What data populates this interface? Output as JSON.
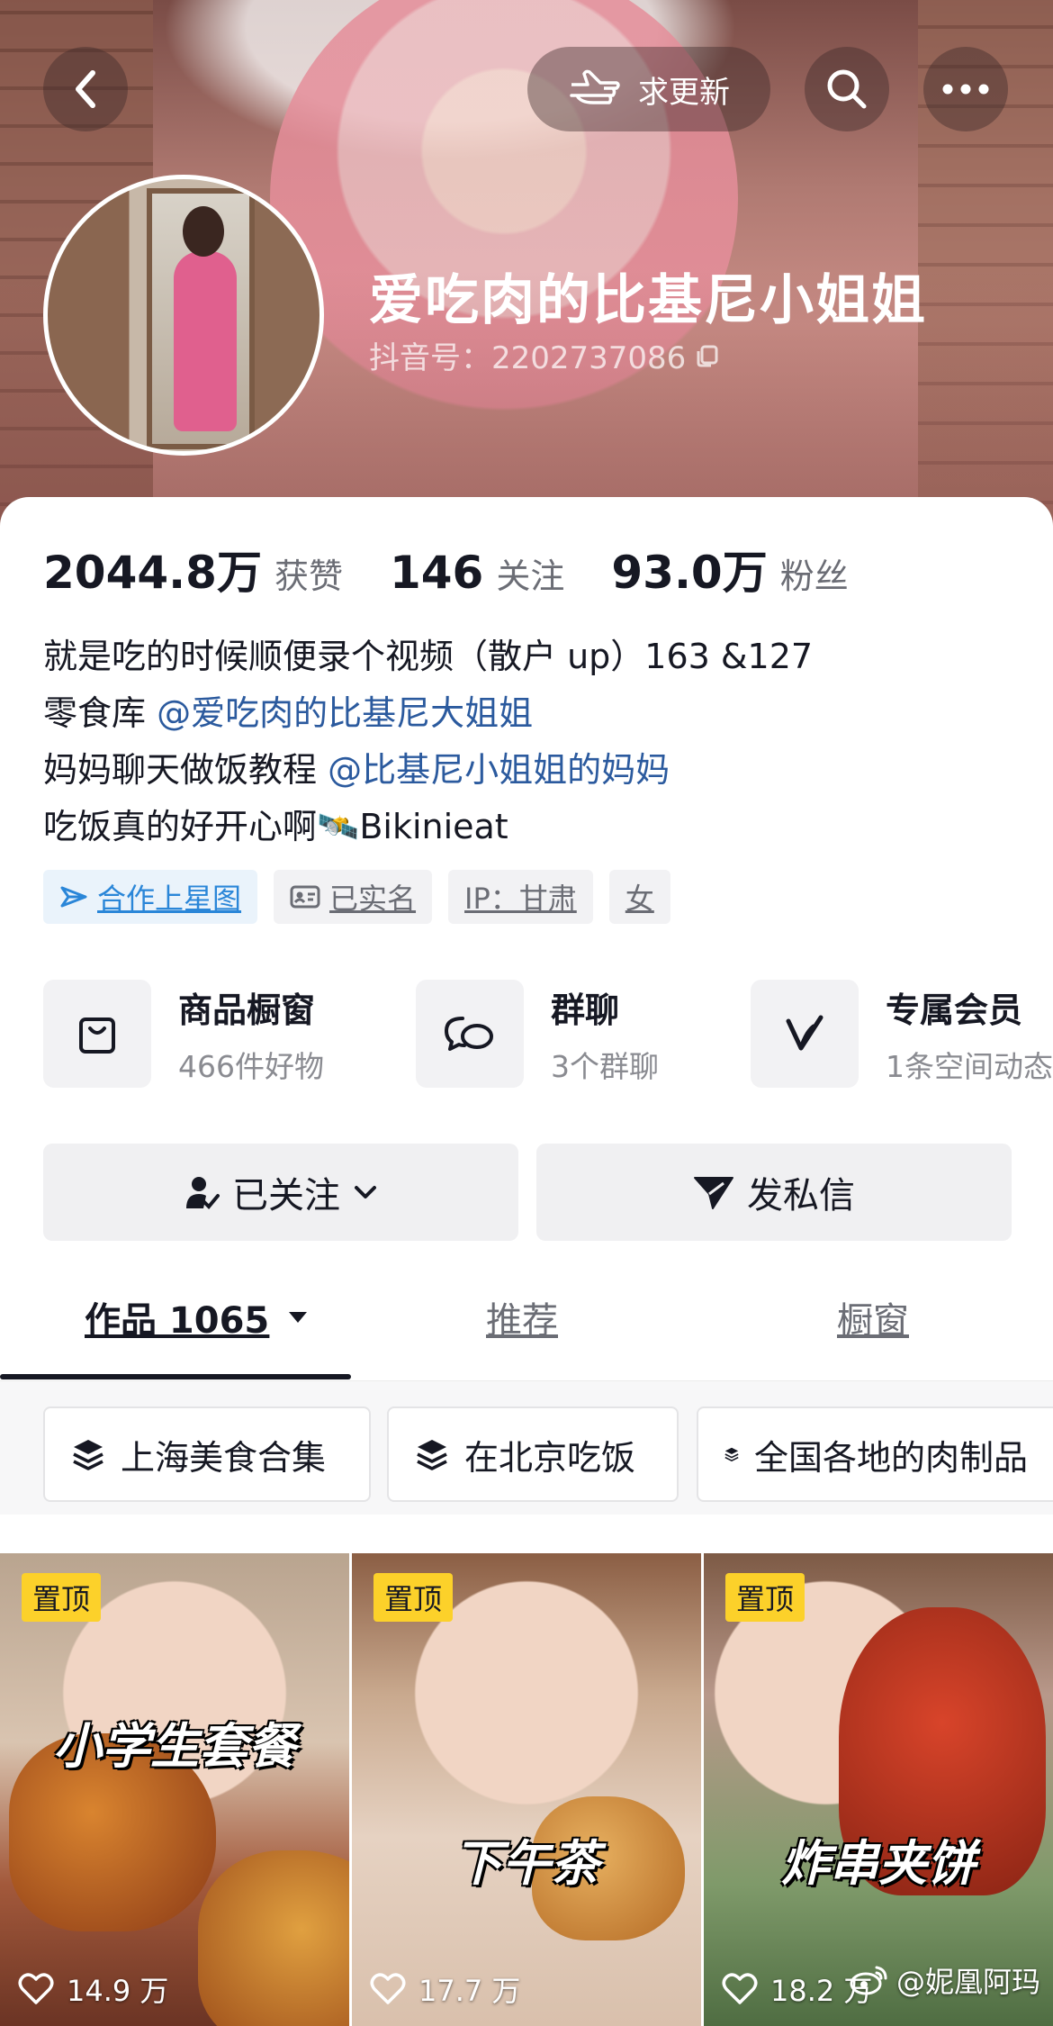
{
  "header": {
    "update_label": "求更新",
    "username": "爱吃肉的比基尼小姐姐",
    "douyin_id": "抖音号：2202737086"
  },
  "stats": {
    "likes_value": "2044.8万",
    "likes_label": "获赞",
    "following_value": "146",
    "following_label": "关注",
    "followers_value": "93.0万",
    "followers_label": "粉丝"
  },
  "bio": {
    "line1": "就是吃的时候顺便录个视频（散户 up）163 &127",
    "line2_prefix": "零食库 ",
    "line2_mention": "@爱吃肉的比基尼大姐姐",
    "line3_prefix": "妈妈聊天做饭教程 ",
    "line3_mention": "@比基尼小姐姐的妈妈",
    "line4": "吃饭真的好开心啊🛰️Bikinieat"
  },
  "tags": {
    "star_map": "合作上星图",
    "verified": "已实名",
    "ip": "IP：甘肃",
    "gender": "女"
  },
  "features": [
    {
      "title": "商品橱窗",
      "subtitle": "466件好物",
      "icon": "shopping-bag-icon"
    },
    {
      "title": "群聊",
      "subtitle": "3个群聊",
      "icon": "chat-bubbles-icon"
    },
    {
      "title": "专属会员",
      "subtitle": "1条空间动态",
      "icon": "vip-v-icon"
    }
  ],
  "actions": {
    "followed_label": "已关注",
    "message_label": "发私信"
  },
  "tabs": {
    "works": "作品 1065",
    "recommend": "推荐",
    "showcase": "橱窗"
  },
  "collections": [
    "上海美食合集",
    "在北京吃饭",
    "全国各地的肉制品"
  ],
  "videos": [
    {
      "pin": "置顶",
      "title": "小学生套餐",
      "likes": "14.9 万"
    },
    {
      "pin": "置顶",
      "title": "下午茶",
      "likes": "17.7 万"
    },
    {
      "pin": "置顶",
      "title": "炸串夹饼",
      "likes": "18.2 万"
    }
  ],
  "watermark": "@妮凰阿玛",
  "colors": {
    "pin_yellow": "#fcd12a",
    "mention_blue": "#2b5a9e",
    "star_map_blue": "#2a86d8"
  }
}
